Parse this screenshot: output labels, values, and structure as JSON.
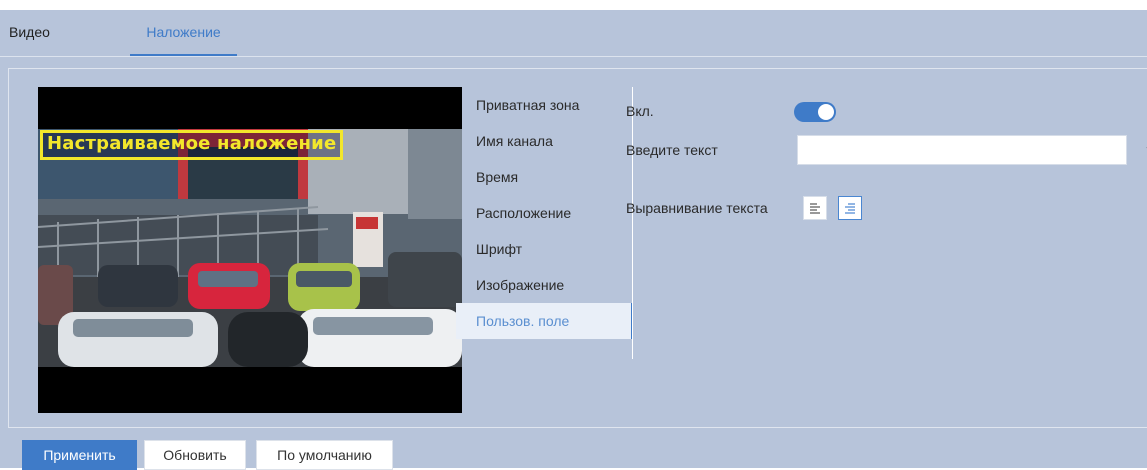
{
  "tabs": [
    {
      "label": "Видео",
      "active": false
    },
    {
      "label": "Наложение",
      "active": true
    }
  ],
  "preview": {
    "overlay_text": "Настраиваемое наложение"
  },
  "menu": {
    "items": [
      {
        "label": "Приватная зона",
        "active": false
      },
      {
        "label": "Имя канала",
        "active": false
      },
      {
        "label": "Время",
        "active": false
      },
      {
        "label": "Расположение",
        "active": false
      },
      {
        "label": "Шрифт",
        "active": false
      },
      {
        "label": "Изображение",
        "active": false
      },
      {
        "label": "Пользов. поле",
        "active": true
      }
    ]
  },
  "form": {
    "enable_label": "Вкл.",
    "enable_value": true,
    "text_label": "Введите текст",
    "text_value": "",
    "align_label": "Выравнивание текста",
    "align_selected": "right"
  },
  "buttons": {
    "apply": "Применить",
    "refresh": "Обновить",
    "default": "По умолчанию"
  },
  "colors": {
    "accent": "#3f7bc8",
    "panel_bg": "#b7c4da",
    "overlay_text": "#f3e72b"
  }
}
